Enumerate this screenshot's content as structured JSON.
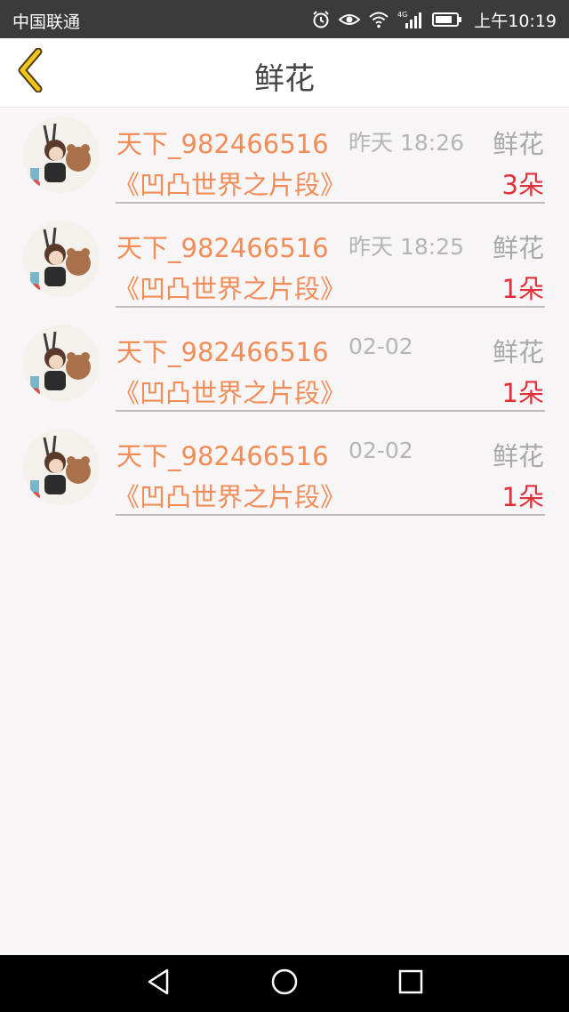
{
  "status_bar": {
    "carrier": "中国联通",
    "network": "4G",
    "time": "上午10:19",
    "icons": [
      "alarm-icon",
      "eye-icon",
      "wifi-icon",
      "signal-icon",
      "battery-icon"
    ]
  },
  "header": {
    "back_icon": "chevron-left-icon",
    "title": "鲜花",
    "accent_color": "#f0c419"
  },
  "list": {
    "items": [
      {
        "user": "天下_982466516",
        "time": "昨天 18:26",
        "gift": "鲜花",
        "work": "《凹凸世界之片段》",
        "count": "3朵"
      },
      {
        "user": "天下_982466516",
        "time": "昨天 18:25",
        "gift": "鲜花",
        "work": "《凹凸世界之片段》",
        "count": "1朵"
      },
      {
        "user": "天下_982466516",
        "time": "02-02",
        "gift": "鲜花",
        "work": "《凹凸世界之片段》",
        "count": "1朵"
      },
      {
        "user": "天下_982466516",
        "time": "02-02",
        "gift": "鲜花",
        "work": "《凹凸世界之片段》",
        "count": "1朵"
      }
    ]
  },
  "colors": {
    "name_color": "#f08d58",
    "count_color": "#e0313a",
    "muted_color": "#b5b5b5"
  },
  "nav_bar": {
    "buttons": [
      "back-triangle-icon",
      "home-circle-icon",
      "recents-square-icon"
    ]
  }
}
